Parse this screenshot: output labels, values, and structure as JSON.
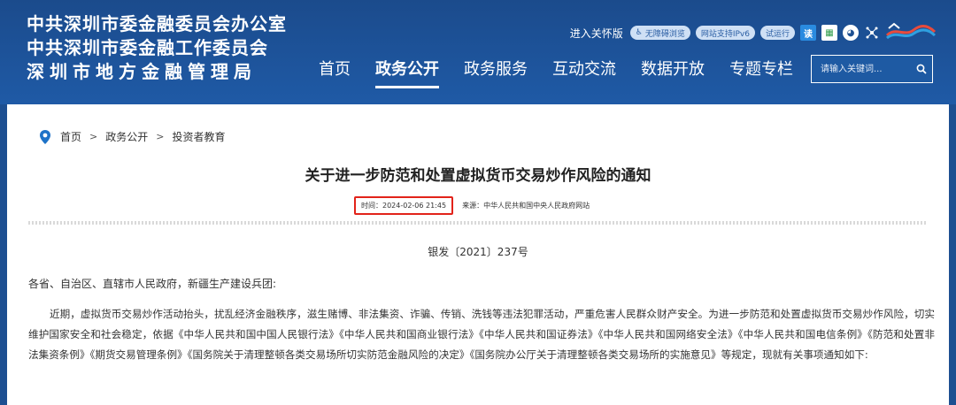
{
  "header": {
    "org_lines": [
      "中共深圳市委金融委员会办公室",
      "中共深圳市委金融工作委员会",
      "深圳市地方金融管理局"
    ],
    "care_link": "进入关怀版",
    "pills": [
      "无障碍浏览",
      "网站支持IPv6",
      "试运行"
    ],
    "icons": [
      "accessibility-icon",
      "read-icon",
      "wechat-icon",
      "weibo-icon",
      "network-icon",
      "shenzhen-logo"
    ],
    "nav": [
      "首页",
      "政务公开",
      "政务服务",
      "互动交流",
      "数据开放",
      "专题专栏"
    ],
    "nav_active_index": 1,
    "search_placeholder": "请输入关键词...",
    "accent_color": "#1d4f91"
  },
  "breadcrumb": [
    "首页",
    "政务公开",
    "投资者教育"
  ],
  "article": {
    "title": "关于进一步防范和处置虚拟货币交易炒作风险的通知",
    "time": "时间：2024-02-06 21:45",
    "source": "来源：中华人民共和国中央人民政府网站",
    "doc_number": "银发〔2021〕237号",
    "recipient": "各省、自治区、直辖市人民政府，新疆生产建设兵团:",
    "paragraph": "近期，虚拟货币交易炒作活动抬头，扰乱经济金融秩序，滋生赌博、非法集资、诈骗、传销、洗钱等违法犯罪活动，严重危害人民群众财产安全。为进一步防范和处置虚拟货币交易炒作风险，切实维护国家安全和社会稳定，依据《中华人民共和国中国人民银行法》《中华人民共和国商业银行法》《中华人民共和国证券法》《中华人民共和国网络安全法》《中华人民共和国电信条例》《防范和处置非法集资条例》《期货交易管理条例》《国务院关于清理整顿各类交易场所切实防范金融风险的决定》《国务院办公厅关于清理整顿各类交易场所的实施意见》等规定，现就有关事项通知如下:"
  }
}
